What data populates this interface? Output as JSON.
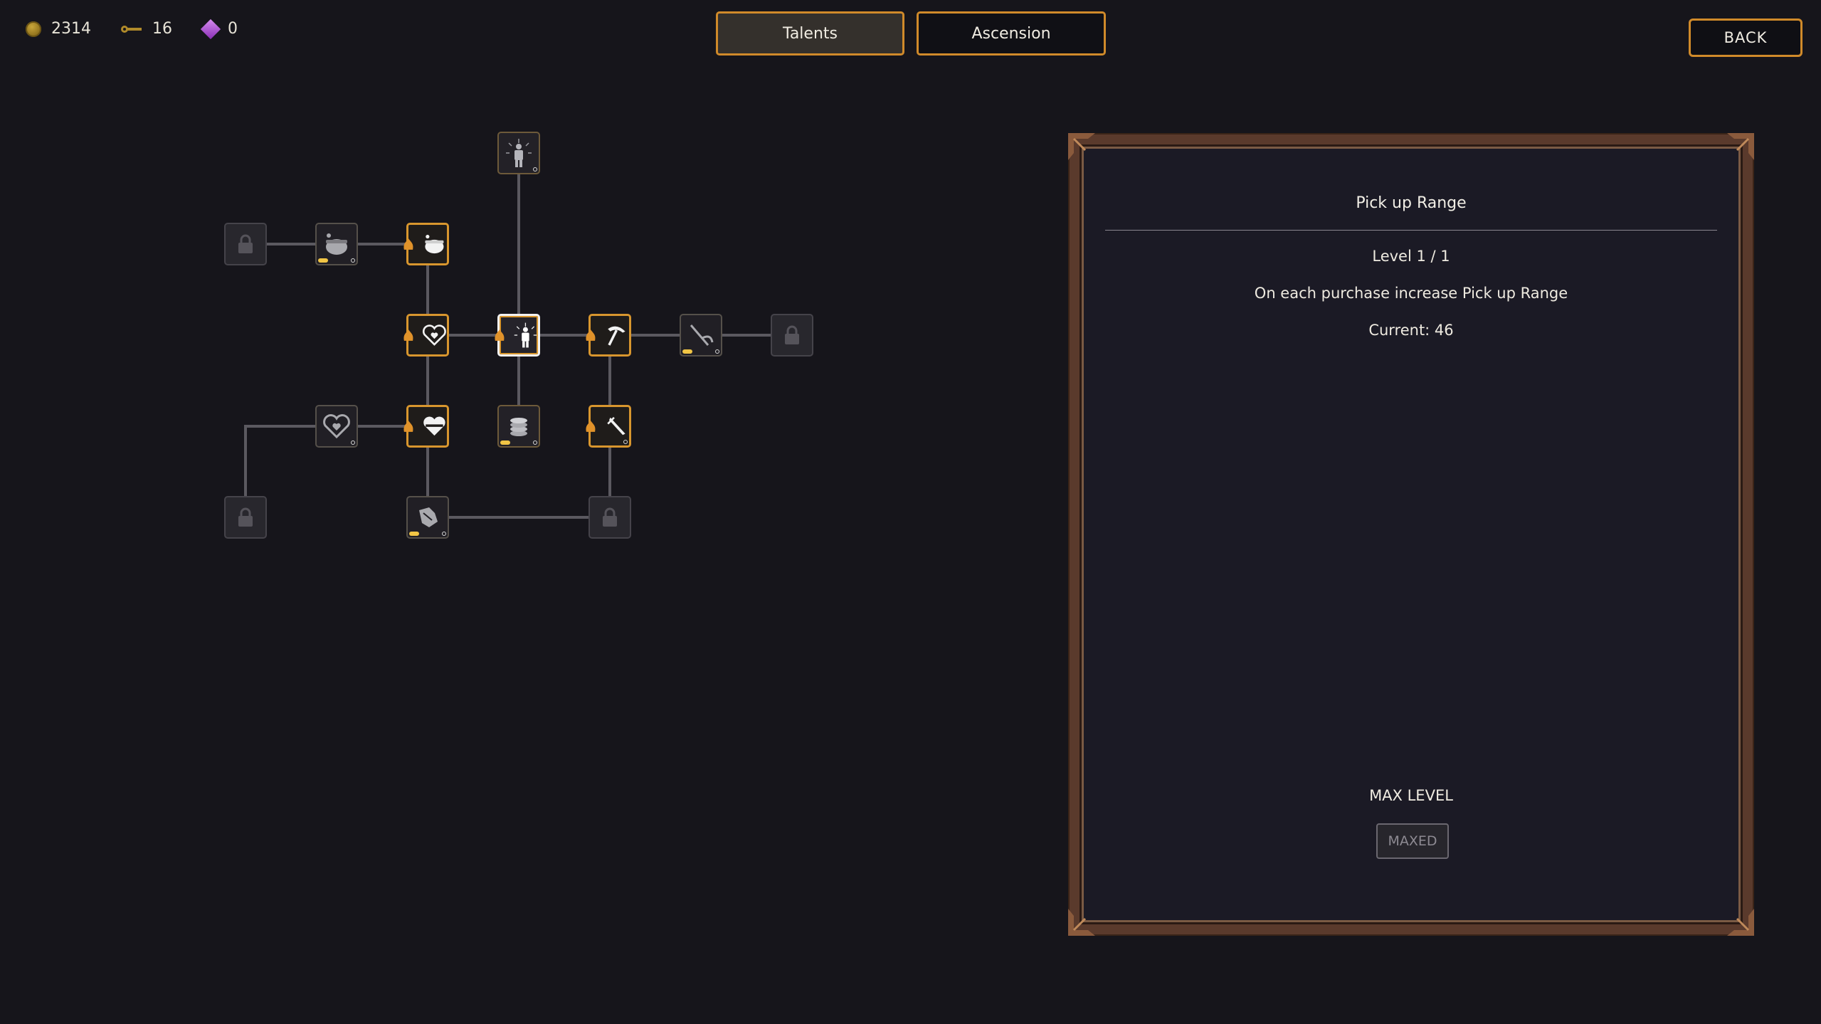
{
  "currencies": [
    {
      "icon": "gold-coin-icon",
      "value": "2314"
    },
    {
      "icon": "key-icon",
      "value": "16"
    },
    {
      "icon": "purple-gem-icon",
      "value": "0"
    }
  ],
  "tabs": [
    {
      "label": "Talents",
      "active": true
    },
    {
      "label": "Ascension",
      "active": false
    }
  ],
  "back_label": "BACK",
  "talent_tree": {
    "nodes": [
      {
        "id": "aura-top",
        "icon": "aura-figure-icon",
        "state": "open"
      },
      {
        "id": "locked-1",
        "icon": "lock-icon",
        "state": "locked"
      },
      {
        "id": "cauldron-dim",
        "icon": "cauldron-icon",
        "state": "dim"
      },
      {
        "id": "cauldron",
        "icon": "cauldron-icon",
        "state": "maxed"
      },
      {
        "id": "heart",
        "icon": "heart-icon",
        "state": "maxed"
      },
      {
        "id": "pickup-range",
        "icon": "aura-figure-icon",
        "state": "selected"
      },
      {
        "id": "pickaxe",
        "icon": "pickaxe-icon",
        "state": "maxed"
      },
      {
        "id": "scythe",
        "icon": "scythe-icon",
        "state": "dim"
      },
      {
        "id": "locked-2",
        "icon": "lock-icon",
        "state": "locked"
      },
      {
        "id": "heart-small",
        "icon": "heart-icon",
        "state": "dim"
      },
      {
        "id": "armor-heart",
        "icon": "armor-heart-icon",
        "state": "maxed"
      },
      {
        "id": "coin-stack",
        "icon": "coin-stack-icon",
        "state": "open"
      },
      {
        "id": "dagger",
        "icon": "dagger-icon",
        "state": "maxed"
      },
      {
        "id": "locked-3",
        "icon": "lock-icon",
        "state": "locked"
      },
      {
        "id": "gauntlet",
        "icon": "gauntlet-icon",
        "state": "dim"
      },
      {
        "id": "locked-4",
        "icon": "lock-icon",
        "state": "locked"
      }
    ]
  },
  "detail_panel": {
    "title": "Pick up Range",
    "level": "Level 1 / 1",
    "description": "On each purchase increase Pick up Range",
    "current": "Current: 46",
    "max_label": "MAX LEVEL",
    "button_label": "MAXED"
  },
  "colors": {
    "background": "#16151b",
    "accent_orange": "#d8962e",
    "panel_frame": "#5a3a2c",
    "panel_bg": "#1b1a25"
  }
}
